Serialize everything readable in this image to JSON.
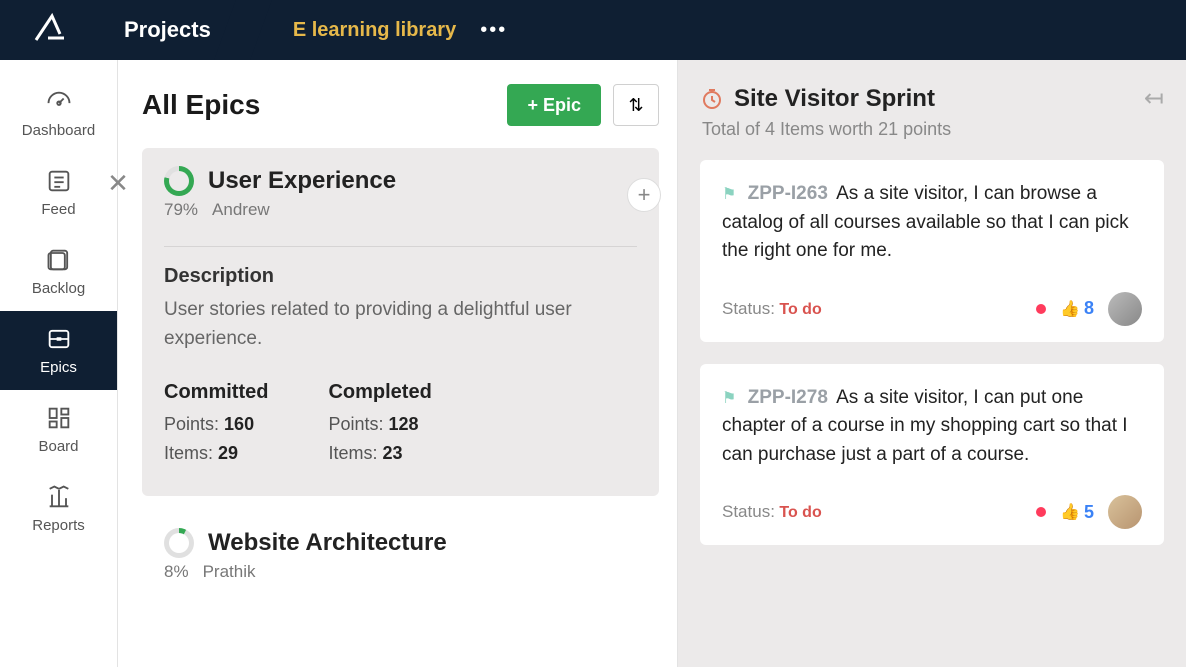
{
  "topbar": {
    "projects_label": "Projects",
    "breadcrumb": "E learning library"
  },
  "sidebar": {
    "items": [
      {
        "label": "Dashboard"
      },
      {
        "label": "Feed"
      },
      {
        "label": "Backlog"
      },
      {
        "label": "Epics"
      },
      {
        "label": "Board"
      },
      {
        "label": "Reports"
      }
    ]
  },
  "main": {
    "title": "All Epics",
    "epic_button": "+ Epic",
    "epic1": {
      "title": "User Experience",
      "percent": "79%",
      "owner": "Andrew",
      "desc_label": "Description",
      "desc_text": "User stories related to providing a delightful user experience.",
      "committed_label": "Committed",
      "completed_label": "Completed",
      "committed_points_label": "Points:",
      "committed_points": "160",
      "committed_items_label": "Items:",
      "committed_items": "29",
      "completed_points_label": "Points:",
      "completed_points": "128",
      "completed_items_label": "Items:",
      "completed_items": "23"
    },
    "epic2": {
      "title": "Website Architecture",
      "percent": "8%",
      "owner": "Prathik"
    }
  },
  "right": {
    "title": "Site Visitor Sprint",
    "subtitle": "Total of 4 Items worth 21 points",
    "story1": {
      "id": "ZPP-I263",
      "text": "As a site visitor, I can browse a catalog of all courses available so that I can pick the right one for me.",
      "status_label": "Status:",
      "status_value": "To do",
      "thumbs": "8"
    },
    "story2": {
      "id": "ZPP-I278",
      "text": "As a site visitor, I can put one chapter of a course in my shopping cart so that I can purchase just a part of a course.",
      "status_label": "Status:",
      "status_value": "To do",
      "thumbs": "5"
    }
  }
}
